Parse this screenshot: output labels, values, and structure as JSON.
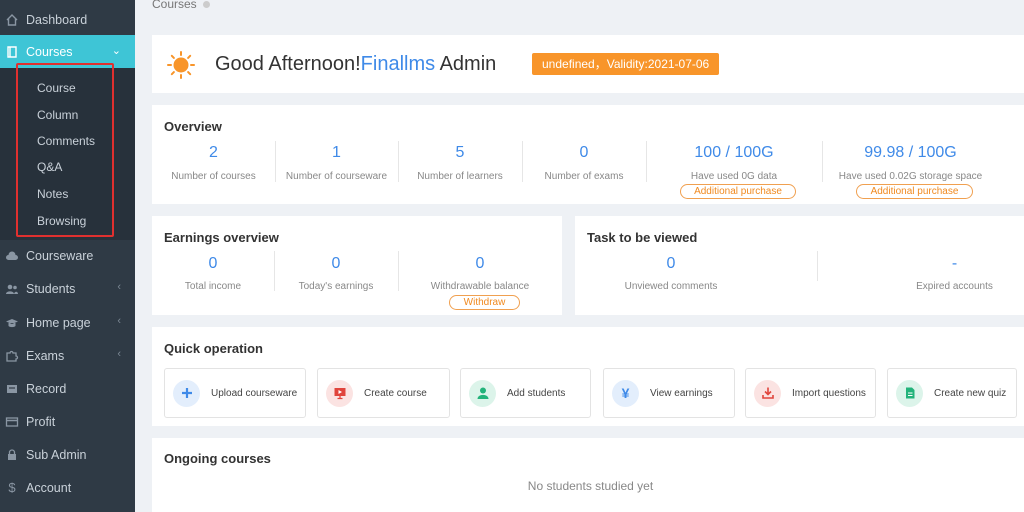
{
  "sidebar": {
    "items": [
      {
        "label": "Dashboard",
        "icon": "home-icon"
      },
      {
        "label": "Courses",
        "icon": "book-icon",
        "active": true
      },
      {
        "label": "Courseware",
        "icon": "cloud-icon"
      },
      {
        "label": "Students",
        "icon": "users-icon"
      },
      {
        "label": "Home page",
        "icon": "graduation-cap-icon"
      },
      {
        "label": "Exams",
        "icon": "puzzle-icon"
      },
      {
        "label": "Record",
        "icon": "archive-icon"
      },
      {
        "label": "Profit",
        "icon": "credit-card-icon"
      },
      {
        "label": "Sub Admin",
        "icon": "lock-icon"
      },
      {
        "label": "Account",
        "icon": "dollar-icon"
      }
    ],
    "subitems": [
      "Course",
      "Column",
      "Comments",
      "Q&A",
      "Notes",
      "Browsing"
    ]
  },
  "breadcrumb": "Courses",
  "greeting": {
    "prefix": "Good Afternoon!",
    "name": "Finallms",
    "suffix": " Admin",
    "badge": "undefined，Validity:2021-07-06"
  },
  "overview": {
    "title": "Overview",
    "stats": [
      {
        "value": "2",
        "label": "Number of courses"
      },
      {
        "value": "1",
        "label": "Number of courseware"
      },
      {
        "value": "5",
        "label": "Number of learners"
      },
      {
        "value": "0",
        "label": "Number of exams"
      },
      {
        "value": "100 / 100G",
        "label": "Have used 0G data",
        "action": "Additional purchase"
      },
      {
        "value": "99.98 / 100G",
        "label": "Have used 0.02G storage space",
        "action": "Additional purchase"
      }
    ]
  },
  "earnings": {
    "title": "Earnings overview",
    "stats": [
      {
        "value": "0",
        "label": "Total income"
      },
      {
        "value": "0",
        "label": "Today's earnings"
      },
      {
        "value": "0",
        "label": "Withdrawable balance",
        "action": "Withdraw"
      }
    ]
  },
  "tasks": {
    "title": "Task to be viewed",
    "stats": [
      {
        "value": "0",
        "label": "Unviewed comments"
      },
      {
        "value": "-",
        "label": "Expired accounts"
      }
    ]
  },
  "quick": {
    "title": "Quick operation",
    "buttons": [
      {
        "label": "Upload courseware",
        "icon": "plus-icon",
        "color": "#3f8ae8",
        "bg": "#e3eefc"
      },
      {
        "label": "Create course",
        "icon": "play-icon",
        "color": "#e0443c",
        "bg": "#fbe3e2"
      },
      {
        "label": "Add students",
        "icon": "user-icon",
        "color": "#22b37a",
        "bg": "#dcf4ea"
      },
      {
        "label": "View earnings",
        "icon": "yen-icon",
        "color": "#3f8ae8",
        "bg": "#e3eefc"
      },
      {
        "label": "Import questions",
        "icon": "download-icon",
        "color": "#e0443c",
        "bg": "#fbe3e2"
      },
      {
        "label": "Create new quiz",
        "icon": "document-icon",
        "color": "#22b37a",
        "bg": "#dcf4ea"
      }
    ]
  },
  "ongoing": {
    "title": "Ongoing courses",
    "empty": "No students studied yet"
  },
  "colors": {
    "sidebar": "#2f3a45",
    "accent": "#3ec5d6",
    "link": "#3f8ae8",
    "badge": "#f8952a"
  }
}
